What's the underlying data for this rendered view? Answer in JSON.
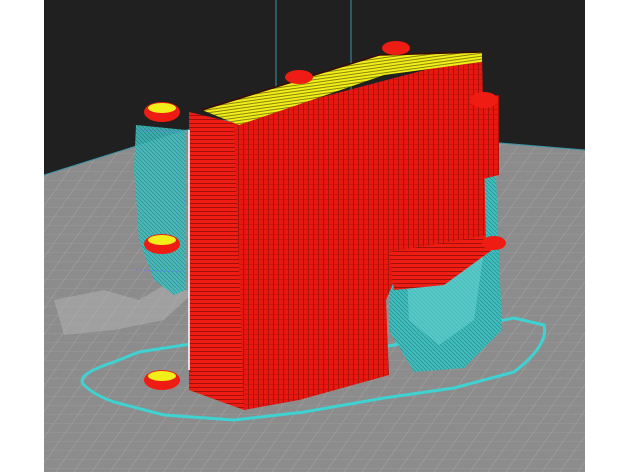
{
  "viewport": {
    "title": "",
    "view": "layer preview",
    "colors": {
      "background": "#1b1b1b",
      "build_plate": "#8c8c8c",
      "plate_grid": "#a7a7a7",
      "axis_line": "#3b93a8",
      "outer_wall": "#ee1c12",
      "top_skin": "#f2ee1a",
      "support": "#38bfbf",
      "skirt": "#3fd2d2",
      "travel": "#6a73ff"
    }
  }
}
